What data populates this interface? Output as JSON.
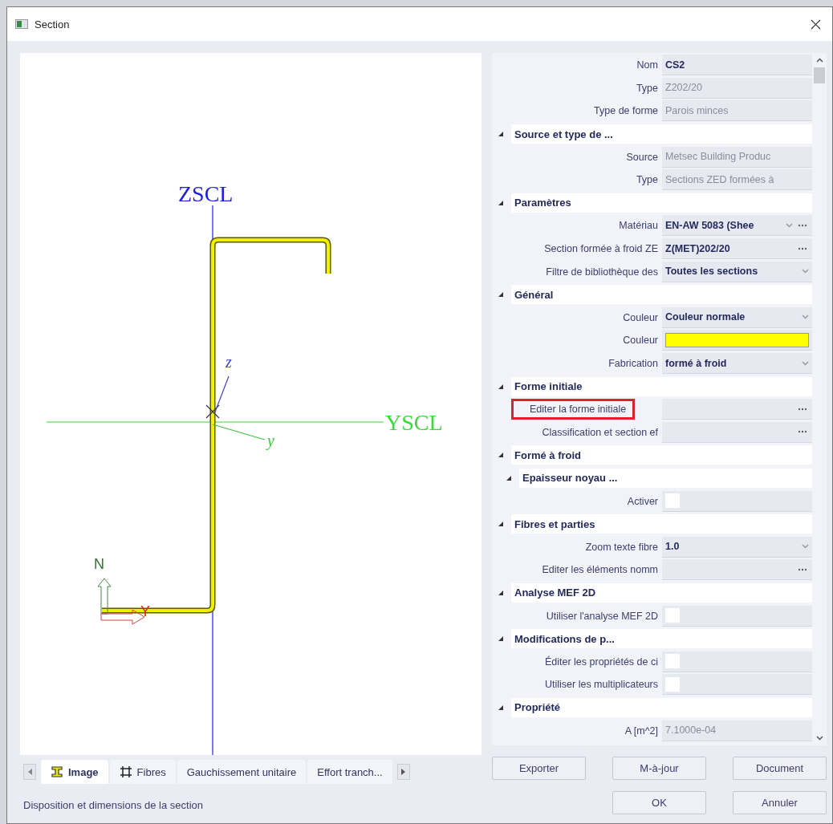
{
  "window": {
    "title": "Section"
  },
  "drawing": {
    "vertical_axis": "ZSCL",
    "horizontal_axis": "YSCL",
    "local_z": "z",
    "local_y": "y",
    "global_z": "N",
    "global_y": "Y"
  },
  "tabs": [
    {
      "label": "Image",
      "selected": true,
      "kind": "section"
    },
    {
      "label": "Fibres",
      "selected": false,
      "kind": "mesh"
    },
    {
      "label": "Gauchissement unitaire",
      "selected": false,
      "kind": "plain"
    },
    {
      "label": "Effort tranch...",
      "selected": false,
      "kind": "plain"
    }
  ],
  "status_bar": "Disposition et dimensions de la section",
  "properties": [
    {
      "kind": "text",
      "label": "Nom",
      "value": "CS2",
      "readonly": false
    },
    {
      "kind": "text",
      "label": "Type",
      "value": "Z202/20",
      "readonly": true
    },
    {
      "kind": "text",
      "label": "Type de forme",
      "value": "Parois minces",
      "readonly": true
    },
    {
      "kind": "group",
      "label": "Source et type de ...",
      "expanded": true,
      "children": [
        {
          "kind": "text",
          "label": "Source",
          "value": "Metsec Building Produc",
          "readonly": true
        },
        {
          "kind": "text",
          "label": "Type",
          "value": "Sections ZED formées à",
          "readonly": true
        }
      ]
    },
    {
      "kind": "group",
      "label": "Paramètres",
      "expanded": true,
      "children": [
        {
          "kind": "dropdown_ellipsis",
          "label": "Matériau",
          "value": "EN-AW 5083 (Shee",
          "readonly": false
        },
        {
          "kind": "ellipsis",
          "label": "Section formée à froid ZE",
          "value": "Z(MET)202/20",
          "readonly": false
        },
        {
          "kind": "dropdown",
          "label": "Filtre de bibliothèque des",
          "value": "Toutes les sections",
          "readonly": false
        }
      ]
    },
    {
      "kind": "group",
      "label": "Général",
      "expanded": true,
      "children": [
        {
          "kind": "dropdown",
          "label": "Couleur",
          "value": "Couleur normale",
          "readonly": false
        },
        {
          "kind": "color",
          "label": "Couleur",
          "color": "#ffff00"
        },
        {
          "kind": "dropdown",
          "label": "Fabrication",
          "value": "formé à froid",
          "readonly": false
        }
      ]
    },
    {
      "kind": "group",
      "label": "Forme initiale",
      "expanded": true,
      "children": [
        {
          "kind": "ellipsis",
          "label": "Editer la forme initiale",
          "highlighted": true
        },
        {
          "kind": "ellipsis",
          "label": "Classification et section ef",
          "highlighted": false
        }
      ]
    },
    {
      "kind": "group",
      "label": "Formé à froid",
      "expanded": true,
      "children": [
        {
          "kind": "group",
          "label": "Epaisseur noyau ...",
          "expanded": true,
          "children": [
            {
              "kind": "checkbox",
              "label": "Activer",
              "checked": false
            }
          ]
        }
      ]
    },
    {
      "kind": "group",
      "label": "Fibres et parties",
      "expanded": true,
      "children": [
        {
          "kind": "dropdown",
          "label": "Zoom texte fibre",
          "value": "1.0",
          "readonly": false
        },
        {
          "kind": "ellipsis",
          "label": "Editer les éléments nomm",
          "highlighted": false
        }
      ]
    },
    {
      "kind": "group",
      "label": "Analyse MEF 2D",
      "expanded": true,
      "children": [
        {
          "kind": "checkbox",
          "label": "Utiliser l'analyse MEF 2D",
          "checked": false
        }
      ]
    },
    {
      "kind": "group",
      "label": "Modifications de p...",
      "expanded": true,
      "children": [
        {
          "kind": "checkbox",
          "label": "Éditer les propriétés de ci",
          "checked": false
        },
        {
          "kind": "checkbox",
          "label": "Utiliser les multiplicateurs",
          "checked": false
        }
      ]
    },
    {
      "kind": "group",
      "label": "Propriété",
      "expanded": true,
      "children": [
        {
          "kind": "text",
          "label": "A [m^2]",
          "value": "7.1000e-04",
          "readonly": true
        }
      ]
    }
  ],
  "buttons": [
    {
      "label": "Exporter"
    },
    {
      "label": "M-à-jour"
    },
    {
      "label": "Document"
    }
  ],
  "dialog_buttons": [
    {
      "label": "OK"
    },
    {
      "label": "Annuler"
    }
  ]
}
